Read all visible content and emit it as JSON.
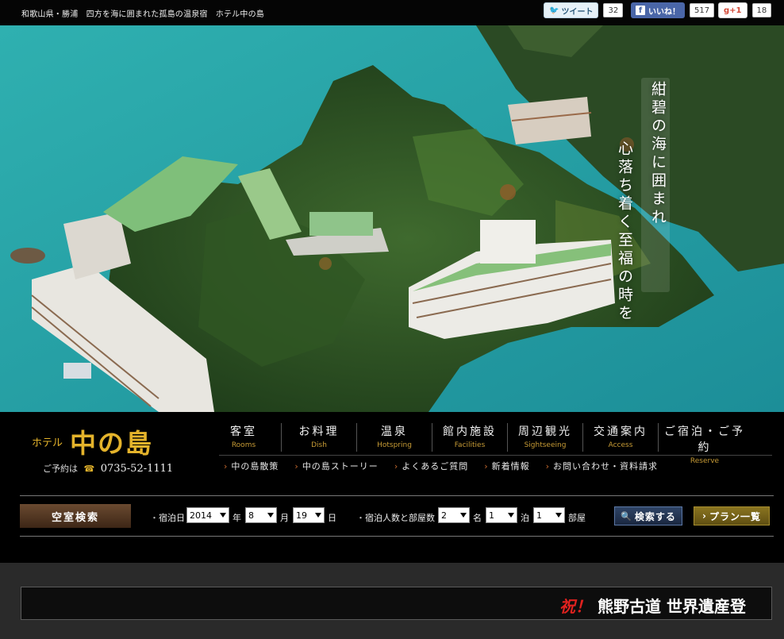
{
  "header": {
    "tagline": "和歌山県・勝浦　四方を海に囲まれた孤島の温泉宿　ホテル中の島",
    "social": {
      "tweet_label": "ツイート",
      "tweet_count": "32",
      "like_label": "いいね！",
      "like_count": "517",
      "gplus_label": "g+1",
      "gplus_count": "18"
    }
  },
  "hero": {
    "line1": "紺碧の海に囲まれ",
    "line2": "心落ち着く至福の時を"
  },
  "logo": {
    "prefix": "ホテル",
    "name": "中の島",
    "reserve_label": "ご予約は",
    "phone": "0735-52-1111"
  },
  "main_nav": [
    {
      "jp": "客室",
      "en": "Rooms"
    },
    {
      "jp": "お料理",
      "en": "Dish"
    },
    {
      "jp": "温泉",
      "en": "Hotspring"
    },
    {
      "jp": "館内施設",
      "en": "Facilities"
    },
    {
      "jp": "周辺観光",
      "en": "Sightseeing"
    },
    {
      "jp": "交通案内",
      "en": "Access"
    },
    {
      "jp": "ご宿泊・ご予約",
      "en": "Reserve"
    }
  ],
  "sub_nav": [
    "中の島散策",
    "中の島ストーリー",
    "よくあるご質問",
    "新着情報",
    "お問い合わせ・資料請求"
  ],
  "search": {
    "title": "空室検索",
    "date_label": "宿泊日",
    "year": "2014",
    "year_unit": "年",
    "month": "8",
    "month_unit": "月",
    "day": "19",
    "day_unit": "日",
    "guests_label": "宿泊人数と部屋数",
    "people": "2",
    "people_unit": "名",
    "nights": "1",
    "nights_unit": "泊",
    "rooms": "1",
    "rooms_unit": "部屋",
    "search_button": "検索する",
    "plan_button": "プラン一覧"
  },
  "ticker": {
    "prefix": "祝！",
    "text": "熊野古道 世界遺産登"
  },
  "colors": {
    "accent_gold": "#e4b32b",
    "sea": "#2aa3a6",
    "search_blue": "#2e4466",
    "plan_gold": "#8a7420",
    "ticker_red": "#e0221f"
  },
  "icons": [
    "twitter-bird-icon",
    "facebook-f-icon",
    "phone-icon",
    "magnifier-icon",
    "chevron-right-icon"
  ]
}
